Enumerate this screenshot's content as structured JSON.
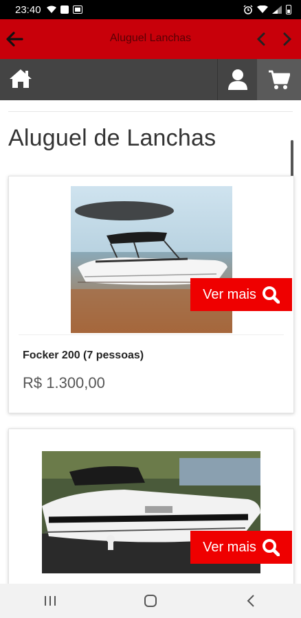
{
  "status": {
    "time": "23:40"
  },
  "appbar": {
    "title": "Aluguel Lanchas"
  },
  "page": {
    "title": "Aluguel de Lanchas"
  },
  "products": [
    {
      "name": "Focker 200 (7 pessoas)",
      "price": "R$ 1.300,00",
      "button": "Ver mais"
    },
    {
      "name": "",
      "price": "",
      "button": "Ver mais"
    }
  ],
  "colors": {
    "appbar": "#c8000a",
    "toolbar": "#444444",
    "button": "#ef0000"
  },
  "icons": [
    "back-arrow-icon",
    "chevron-left-icon",
    "chevron-right-icon",
    "home-icon",
    "user-icon",
    "cart-icon",
    "search-icon",
    "recent-apps-icon",
    "home-circle-icon",
    "back-icon"
  ]
}
